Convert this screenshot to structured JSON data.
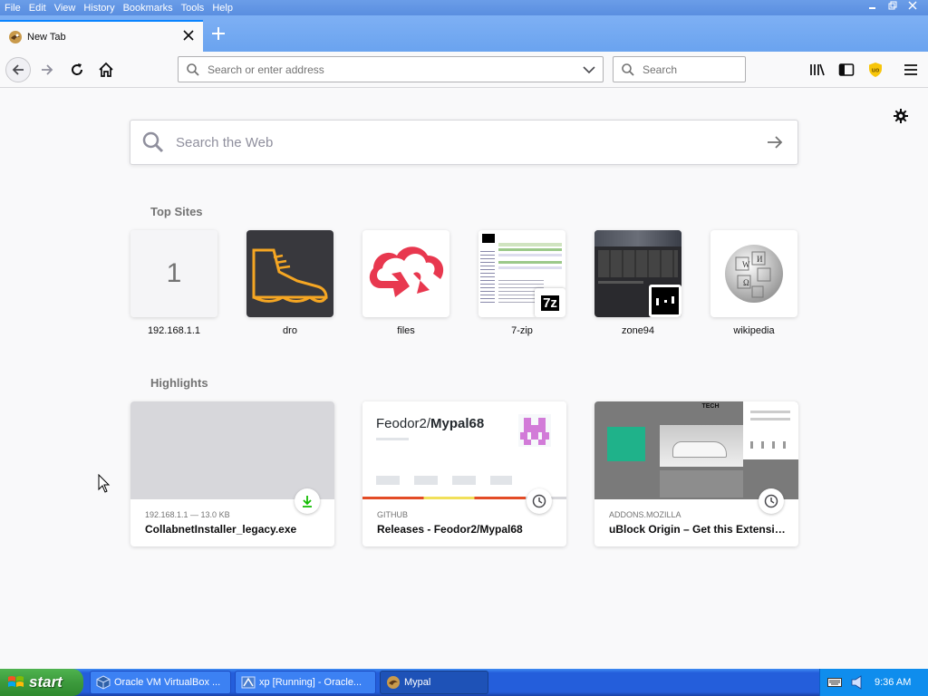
{
  "menubar": {
    "items": [
      "File",
      "Edit",
      "View",
      "History",
      "Bookmarks",
      "Tools",
      "Help"
    ]
  },
  "tab": {
    "title": "New Tab"
  },
  "navbar": {
    "url_placeholder": "Search or enter address",
    "search_placeholder": "Search"
  },
  "newtab": {
    "search_placeholder": "Search the Web",
    "top_sites_title": "Top Sites",
    "top_sites": [
      {
        "label": "192.168.1.1",
        "tile_text": "1"
      },
      {
        "label": "dro"
      },
      {
        "label": "files"
      },
      {
        "label": "7-zip",
        "badge_text": "7z"
      },
      {
        "label": "zone94"
      },
      {
        "label": "wikipedia"
      }
    ],
    "highlights_title": "Highlights",
    "highlights": [
      {
        "source": "192.168.1.1 — 13.0 KB",
        "title": "CollabnetInstaller_legacy.exe",
        "badge": "download-icon"
      },
      {
        "source": "GITHUB",
        "title": "Releases - Feodor2/Mypal68",
        "badge": "clock-icon",
        "preview_title_a": "Feodor2/",
        "preview_title_b": "Mypal68"
      },
      {
        "source": "ADDONS.MOZILLA",
        "title": "uBlock Origin – Get this Extensio…",
        "badge": "clock-icon",
        "preview_header": "TECH"
      }
    ]
  },
  "taskbar": {
    "start_label": "start",
    "tasks": [
      {
        "label": "Oracle VM VirtualBox ..."
      },
      {
        "label": "xp [Running] - Oracle..."
      },
      {
        "label": "Mypal"
      }
    ],
    "clock": "9:36 AM"
  },
  "colors": {
    "accent": "#0a84ff",
    "titlebar": "#6b9de8",
    "taskbar": "#245edb",
    "start_green": "#3c9a3c"
  }
}
